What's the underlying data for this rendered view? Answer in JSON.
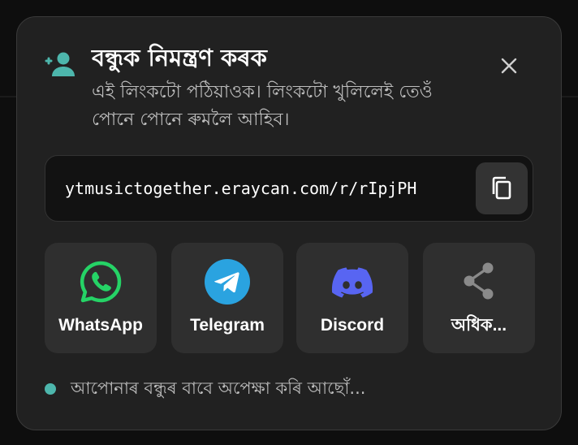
{
  "dialog": {
    "title": "বন্ধুক নিমন্ত্ৰণ কৰক",
    "subtitle": "এই লিংকটো পঠিয়াওক। লিংকটো খুলিলেই তেওঁ পোনে পোনে ৰুমলৈ আহিব।",
    "close_icon": "close-icon",
    "header_icon": "person-add-icon"
  },
  "invite": {
    "link": "ytmusictogether.eraycan.com/r/rIpjPH",
    "copy_icon": "copy-icon"
  },
  "share_buttons": [
    {
      "label": "WhatsApp",
      "icon": "whatsapp-icon",
      "color": "#25d366"
    },
    {
      "label": "Telegram",
      "icon": "telegram-icon",
      "color": "#2aa3e0"
    },
    {
      "label": "Discord",
      "icon": "discord-icon",
      "color": "#5865f2"
    },
    {
      "label": "অধিক...",
      "icon": "share-icon",
      "color": "#8a8a8a"
    }
  ],
  "status": {
    "text": "আপোনাৰ বন্ধুৰ বাবে অপেক্ষা কৰি আছোঁ...",
    "dot_color": "#4db6ac"
  },
  "colors": {
    "accent": "#4db6ac",
    "surface": "#212121",
    "button_surface": "#2f2f2f"
  }
}
